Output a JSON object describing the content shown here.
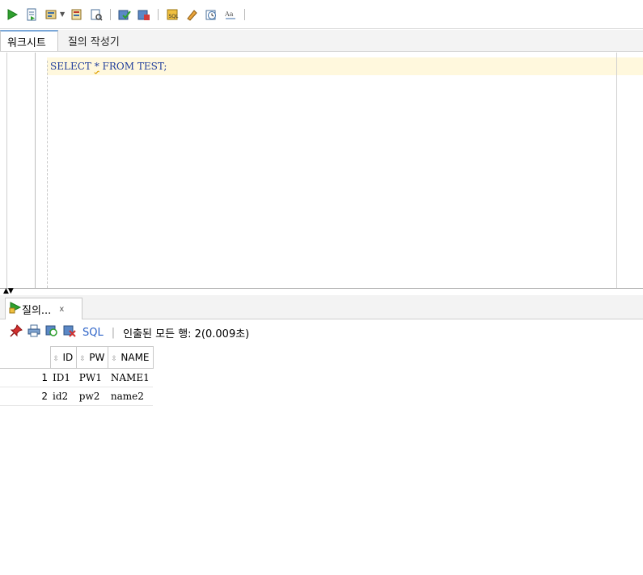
{
  "toolbar": {
    "icons": [
      "run-statement-icon",
      "run-script-icon",
      "autotrace-icon",
      "explain-plan-icon",
      "sql-tuning-icon",
      "commit-icon",
      "rollback-icon",
      "unshared-sql-icon",
      "clear-icon",
      "history-icon",
      "format-icon"
    ]
  },
  "editor_tabs": {
    "worksheet": "워크시트",
    "query_builder": "질의 작성기"
  },
  "editor": {
    "sql_before": "SELECT ",
    "sql_star": "*",
    "sql_after": " FROM TEST;"
  },
  "results_tab": {
    "label": "질의...",
    "close": "x"
  },
  "results_toolbar": {
    "sql_label": "SQL",
    "separator": "|",
    "status": "인출된 모든 행: 2(0.009초)"
  },
  "grid": {
    "columns": [
      "ID",
      "PW",
      "NAME"
    ],
    "rows": [
      {
        "num": "1",
        "cells": [
          "ID1",
          "PW1",
          "NAME1"
        ]
      },
      {
        "num": "2",
        "cells": [
          "id2",
          "pw2",
          "name2"
        ]
      }
    ]
  },
  "colors": {
    "accent": "#2e64c8",
    "sql_text": "#1f3d9c",
    "current_line": "#fff8dd"
  }
}
